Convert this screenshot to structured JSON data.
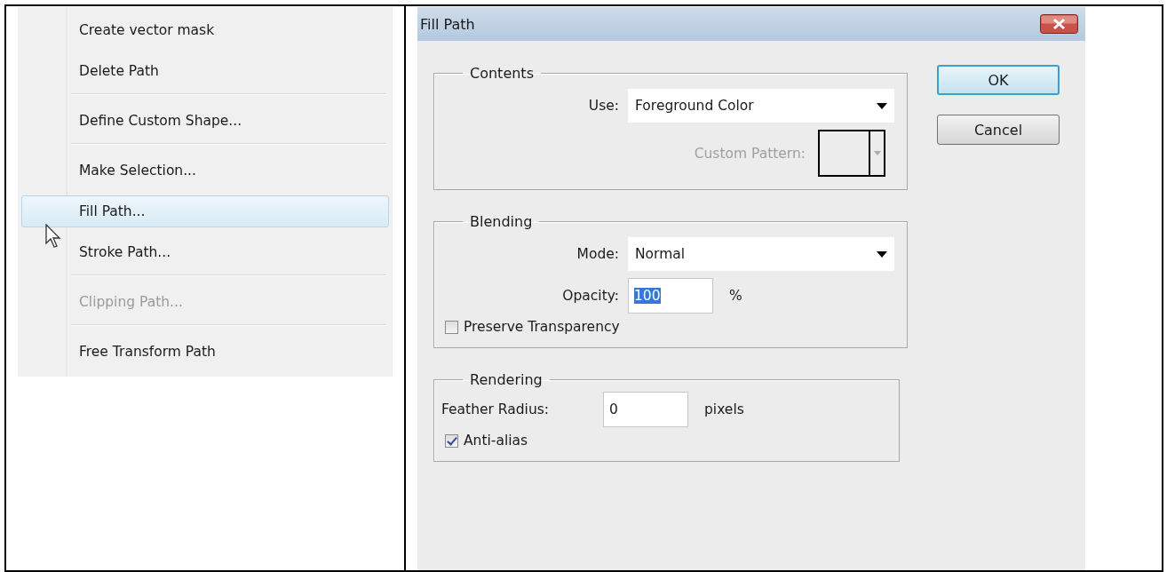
{
  "menu": {
    "items": [
      {
        "kind": "item",
        "label": "Create vector mask",
        "selected": false,
        "disabled": false
      },
      {
        "kind": "item",
        "label": "Delete Path",
        "selected": false,
        "disabled": false
      },
      {
        "kind": "separator"
      },
      {
        "kind": "item",
        "label": "Define Custom Shape...",
        "selected": false,
        "disabled": false
      },
      {
        "kind": "separator"
      },
      {
        "kind": "item",
        "label": "Make Selection...",
        "selected": false,
        "disabled": false
      },
      {
        "kind": "item",
        "label": "Fill Path...",
        "selected": true,
        "disabled": false
      },
      {
        "kind": "item",
        "label": "Stroke Path...",
        "selected": false,
        "disabled": false
      },
      {
        "kind": "separator"
      },
      {
        "kind": "item",
        "label": "Clipping Path...",
        "selected": false,
        "disabled": true
      },
      {
        "kind": "separator"
      },
      {
        "kind": "item",
        "label": "Free Transform Path",
        "selected": false,
        "disabled": false
      }
    ]
  },
  "dialog": {
    "title": "Fill Path",
    "contents": {
      "title": "Contents",
      "use_label": "Use:",
      "use_value": "Foreground Color",
      "pattern_label": "Custom Pattern:",
      "pattern_disabled": true
    },
    "blending": {
      "title": "Blending",
      "mode_label": "Mode:",
      "mode_value": "Normal",
      "opacity_label": "Opacity:",
      "opacity_value": "100",
      "opacity_unit": "%",
      "preserve_label": "Preserve Transparency",
      "preserve_checked": false
    },
    "rendering": {
      "title": "Rendering",
      "feather_label": "Feather Radius:",
      "feather_value": "0",
      "feather_unit": "pixels",
      "antialias_label": "Anti-alias",
      "antialias_checked": true
    },
    "buttons": [
      {
        "label": "OK",
        "default": true
      },
      {
        "label": "Cancel",
        "default": false
      }
    ]
  }
}
